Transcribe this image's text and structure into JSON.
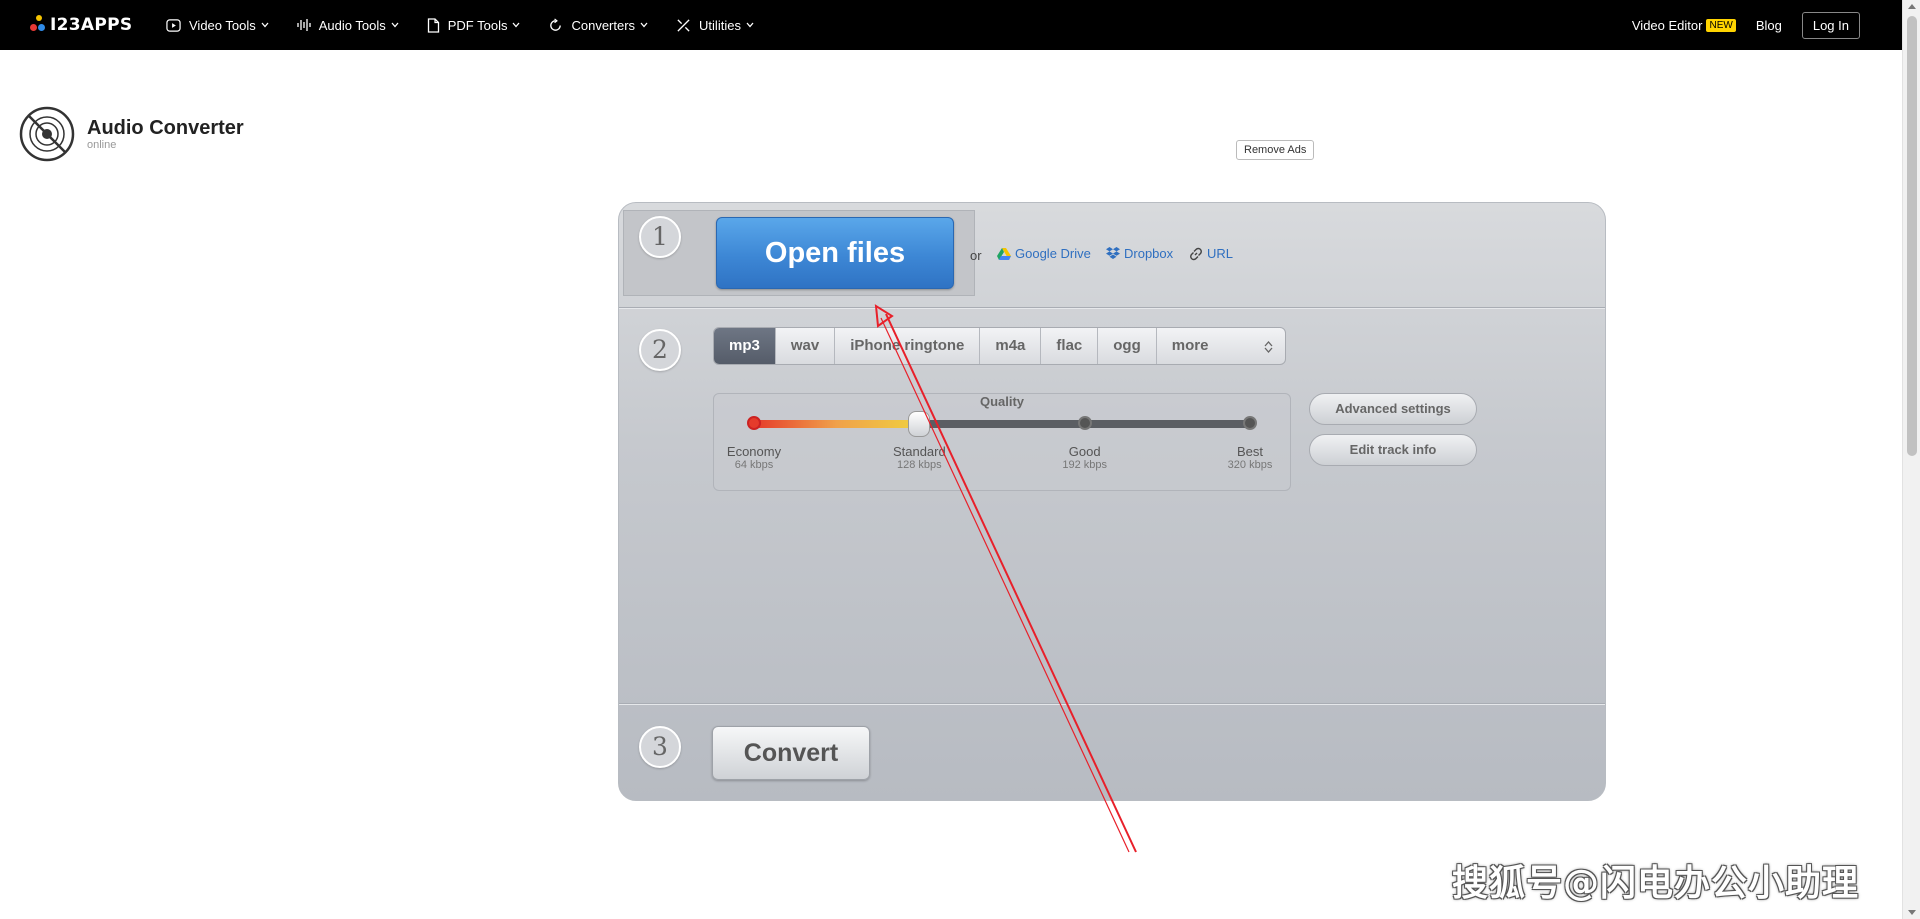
{
  "brand": {
    "logo_text": "I23APPS",
    "dot_colors": [
      "#f5c400",
      "#e53935",
      "#2f8be8"
    ]
  },
  "nav": {
    "items": [
      {
        "label": "Video Tools",
        "icon": "play-circle-icon"
      },
      {
        "label": "Audio Tools",
        "icon": "waveform-icon"
      },
      {
        "label": "PDF Tools",
        "icon": "document-icon"
      },
      {
        "label": "Converters",
        "icon": "refresh-icon"
      },
      {
        "label": "Utilities",
        "icon": "tools-icon"
      }
    ],
    "video_editor": "Video Editor",
    "new_badge": "NEW",
    "blog": "Blog",
    "login": "Log In"
  },
  "app": {
    "title": "Audio Converter",
    "subtitle": "online",
    "remove_ads": "Remove Ads"
  },
  "step1": {
    "number": "1",
    "open_files": "Open files",
    "or": "or",
    "sources": [
      {
        "label": "Google Drive",
        "icon": "google-drive-icon"
      },
      {
        "label": "Dropbox",
        "icon": "dropbox-icon"
      },
      {
        "label": "URL",
        "icon": "link-icon"
      }
    ]
  },
  "step2": {
    "number": "2",
    "formats": [
      "mp3",
      "wav",
      "iPhone ringtone",
      "m4a",
      "flac",
      "ogg"
    ],
    "active_format": "mp3",
    "more": "more",
    "quality": {
      "label": "Quality",
      "selected_index": 1,
      "stops": [
        {
          "name": "Economy",
          "kbps": "64 kbps"
        },
        {
          "name": "Standard",
          "kbps": "128 kbps"
        },
        {
          "name": "Good",
          "kbps": "192 kbps"
        },
        {
          "name": "Best",
          "kbps": "320 kbps"
        }
      ]
    },
    "advanced_settings": "Advanced settings",
    "edit_track_info": "Edit track info"
  },
  "step3": {
    "number": "3",
    "convert": "Convert"
  },
  "watermark": "搜狐号@闪电办公小助理",
  "colors": {
    "topbar": "#000000",
    "open_button": "#3d87d5",
    "link": "#2f6fc0",
    "annotation_arrow": "#e8202a",
    "new_badge": "#ffd400"
  }
}
